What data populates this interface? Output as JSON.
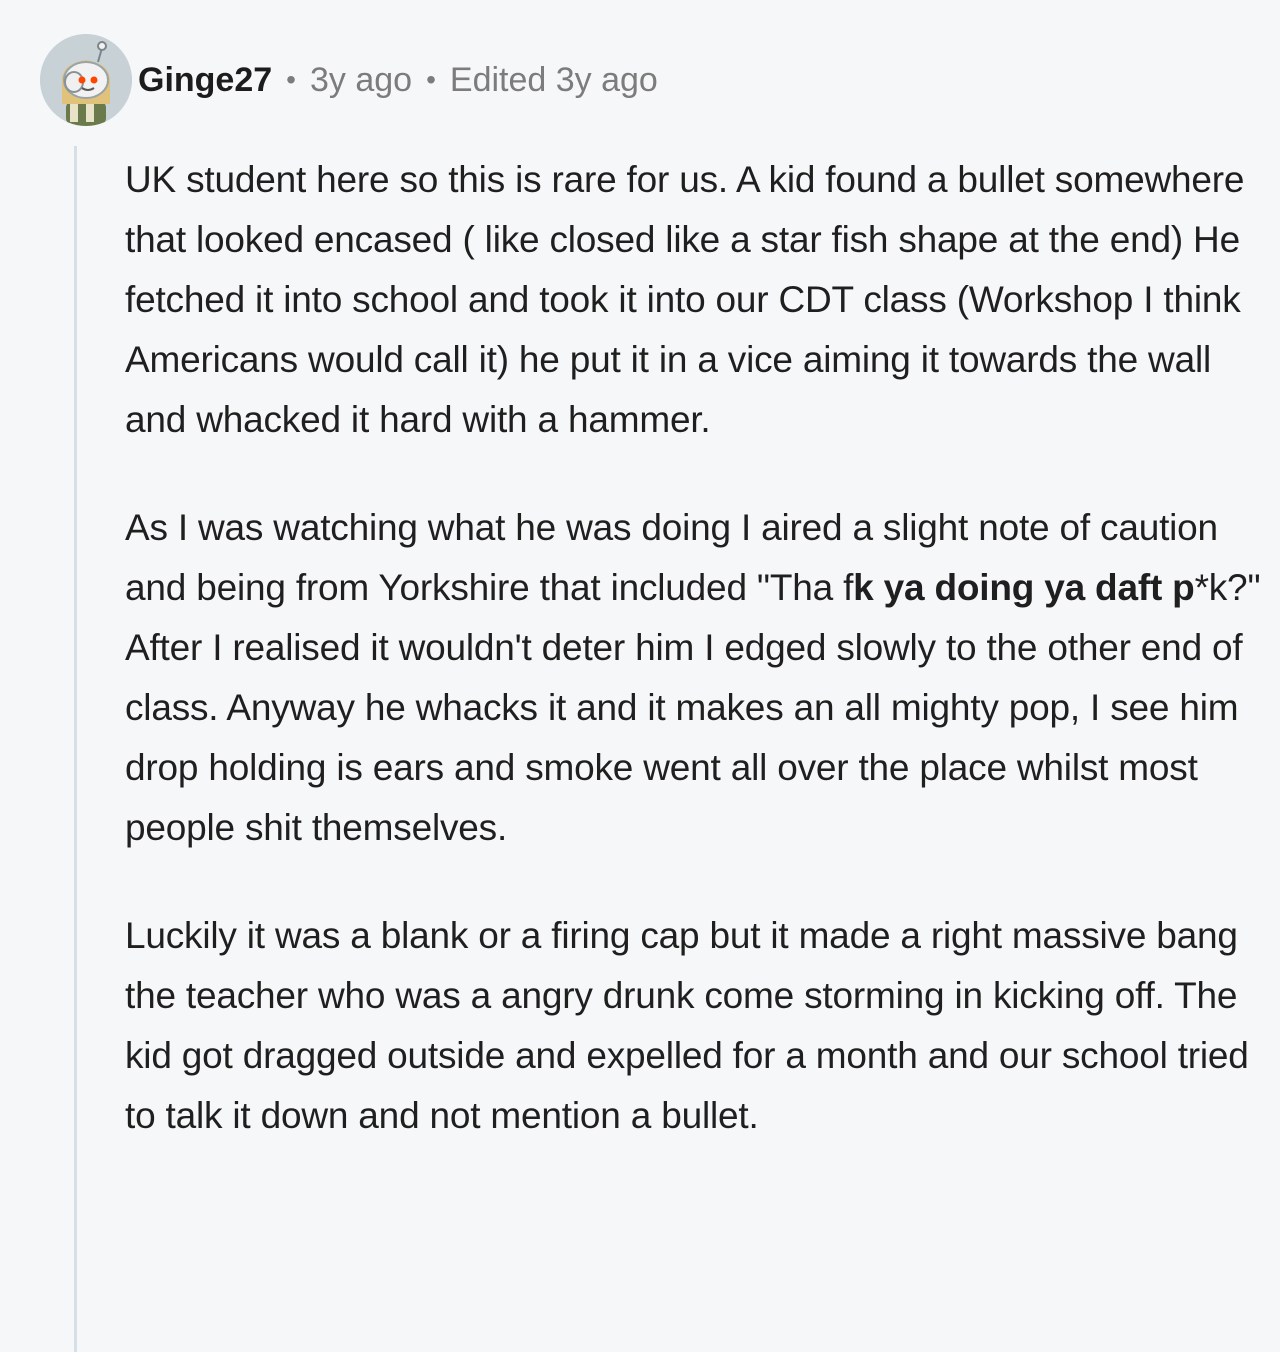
{
  "comment": {
    "author": "Ginge27",
    "separator": "•",
    "posted": "3y ago",
    "edited": "Edited 3y ago",
    "avatar_icon": "snoo-avatar-icon",
    "paragraphs": {
      "p1": "UK student here so this is rare for us. A kid found a bullet somewhere that looked encased ( like closed like a star fish shape at the end) He fetched it into school and took it into our CDT class (Workshop I think Americans would call it) he put it in a vice aiming it towards the wall and whacked it hard with a hammer.",
      "p2_start": "As I was watching what he was doing I aired a slight note of caution and being from Yorkshire that included \"Tha f",
      "p2_bold": "k ya doing ya daft p",
      "p2_end": "*k?\" After I realised it wouldn't deter him I edged slowly to the other end of class. Anyway he whacks it and it makes an all mighty pop, I see him drop holding is ears and smoke went all over the place whilst most people shit themselves.",
      "p3": "Luckily it was a blank or a firing cap but it made a right massive bang the teacher who was a angry drunk come storming in kicking off. The kid got dragged outside and expelled for a month and our school tried to talk it down and not mention a bullet."
    }
  }
}
